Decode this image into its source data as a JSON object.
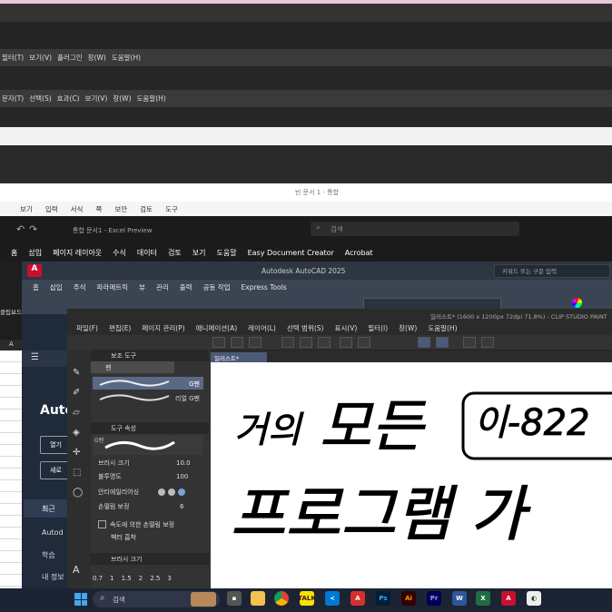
{
  "apps": {
    "generic_menu_1": [
      "필터(T)",
      "보기(V)",
      "플러그인",
      "창(W)",
      "도움말(H)"
    ],
    "generic_menu_2": [
      "문자(T)",
      "선택(S)",
      "효과(C)",
      "보기(V)",
      "창(W)",
      "도움말(H)"
    ],
    "word": {
      "title": "빈 문서 1 - 통합",
      "menu": [
        "보기",
        "입력",
        "서식",
        "쪽",
        "보안",
        "검토",
        "도구"
      ]
    },
    "excel": {
      "title": "통합 문서1 - Excel Preview",
      "search_placeholder": "검색",
      "tabs": [
        "홈",
        "삽입",
        "페이지 레이아웃",
        "수식",
        "데이터",
        "검토",
        "보기",
        "도움말",
        "Easy Document Creator",
        "Acrobat"
      ],
      "left_labels": [
        "클립보드"
      ],
      "cell_label": "A"
    },
    "autocad": {
      "logo": "A",
      "title": "Autodesk AutoCAD 2025",
      "search_placeholder": "키워드 또는 구문 입력",
      "tabs": [
        "홈",
        "삽입",
        "주석",
        "파라메트릭",
        "뷰",
        "관리",
        "출력",
        "공동 작업",
        "Express Tools"
      ],
      "start_title": "Auto",
      "start_buttons": [
        "열기",
        "새로"
      ],
      "start_nav": [
        "최근",
        "Autod",
        "학습",
        "내 정보"
      ]
    },
    "clip_studio": {
      "title": "일러스트* (1600 x 1200px 72dpi 71.8%) - CLIP STUDIO PAINT",
      "menu": [
        "파일(F)",
        "편집(E)",
        "페이지 관리(P)",
        "애니메이션(A)",
        "레이어(L)",
        "선택 범위(S)",
        "표시(V)",
        "필터(I)",
        "창(W)",
        "도움말(H)"
      ],
      "doc_tab": "일러스트*",
      "sub_tool_header": "보조 도구",
      "sub_tool_group": "펜",
      "brushes": [
        "G펜",
        "리얼 G펜"
      ],
      "tool_property_header": "도구 속성",
      "tool_property_brush": "G펜",
      "properties": [
        {
          "label": "브러시 크기",
          "value": "10.0"
        },
        {
          "label": "불투명도",
          "value": "100"
        },
        {
          "label": "안티에일리어싱",
          "value": ""
        },
        {
          "label": "손떨림 보정",
          "value": "6"
        },
        {
          "label": "속도에 의한 손떨림 보정",
          "value": ""
        },
        {
          "label": "벡터 흡착",
          "value": ""
        }
      ],
      "brush_size_header": "브러시 크기",
      "brush_sizes": [
        "0.7",
        "1",
        "1.5",
        "2",
        "2.5",
        "3"
      ]
    },
    "canvas_text": {
      "line1_a": "거의",
      "line1_b": "모든",
      "line1_c": "이-822",
      "line2": "프로그램 가"
    },
    "taskbar": {
      "search_placeholder": "검색",
      "icons": [
        "windows-logo",
        "widgets",
        "file-explorer",
        "chrome",
        "kakaotalk",
        "vscode",
        "acrobat",
        "photoshop",
        "illustrator",
        "premiere",
        "word",
        "excel",
        "autocad",
        "clip-studio"
      ]
    }
  },
  "colors": {
    "autocad_red": "#c8102e",
    "excel_green": "#1d6f42",
    "photoshop": "#31a8ff",
    "illustrator": "#ff9a00",
    "premiere": "#9999ff"
  }
}
